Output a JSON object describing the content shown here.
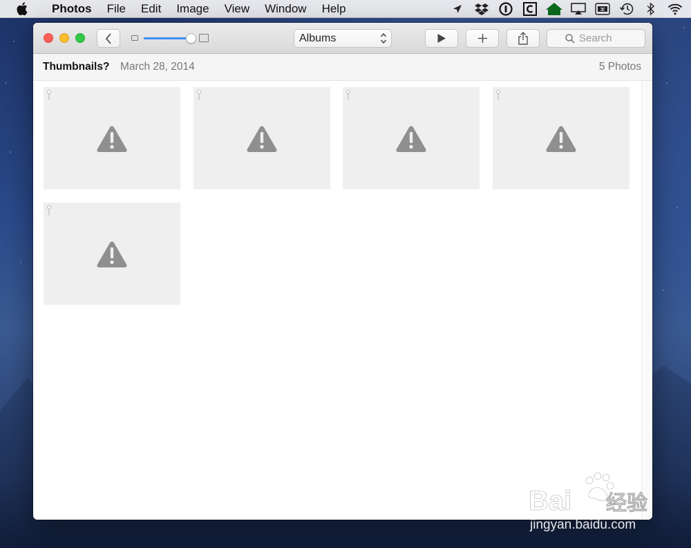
{
  "menubar": {
    "app_name": "Photos",
    "items": [
      "File",
      "Edit",
      "Image",
      "View",
      "Window",
      "Help"
    ],
    "status_icons": [
      "location-icon",
      "dropbox-icon",
      "onepassword-icon",
      "c-app-icon",
      "home-icon",
      "airplay-icon",
      "keyboard-icon",
      "time-machine-icon",
      "bluetooth-icon",
      "wifi-icon"
    ]
  },
  "toolbar": {
    "album_select": "Albums",
    "search_placeholder": "Search",
    "zoom_level": 0.95
  },
  "info": {
    "title": "Thumbnails?",
    "date": "March 28, 2014",
    "count": "5 Photos"
  },
  "photos": [
    {
      "state": "missing"
    },
    {
      "state": "missing"
    },
    {
      "state": "missing"
    },
    {
      "state": "missing"
    },
    {
      "state": "missing"
    }
  ],
  "colors": {
    "accent": "#3d8ef3",
    "close": "#fc5f57",
    "minimize": "#fdbc2e",
    "maximize": "#33c748"
  }
}
